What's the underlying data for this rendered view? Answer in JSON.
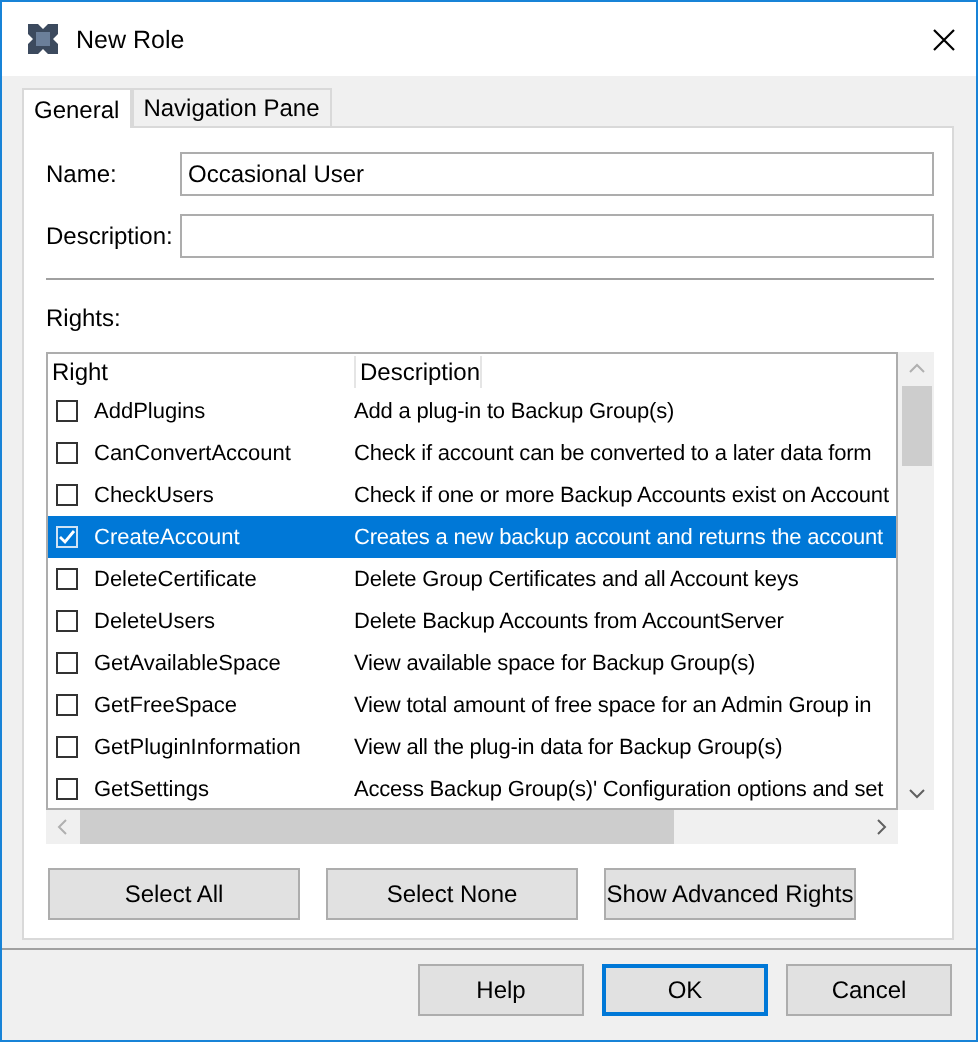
{
  "window": {
    "title": "New Role"
  },
  "tabs": [
    {
      "label": "General",
      "selected": true
    },
    {
      "label": "Navigation Pane",
      "selected": false
    }
  ],
  "name_field": {
    "label": "Name:",
    "value": "Occasional User"
  },
  "description_field": {
    "label": "Description:"
  },
  "rights": {
    "label": "Rights:",
    "columns": [
      "Right",
      "Description"
    ],
    "rows": [
      {
        "name": "AddPlugins",
        "description": "Add a plug-in to Backup Group(s)",
        "checked": false,
        "selected": false
      },
      {
        "name": "CanConvertAccount",
        "description": "Check if account can be converted to a later data form",
        "checked": false,
        "selected": false
      },
      {
        "name": "CheckUsers",
        "description": "Check if one or more Backup Accounts exist on Account",
        "checked": false,
        "selected": false
      },
      {
        "name": "CreateAccount",
        "description": "Creates a new backup account and returns the account",
        "checked": true,
        "selected": true
      },
      {
        "name": "DeleteCertificate",
        "description": "Delete Group Certificates and all Account keys",
        "checked": false,
        "selected": false
      },
      {
        "name": "DeleteUsers",
        "description": "Delete Backup Accounts from AccountServer",
        "checked": false,
        "selected": false
      },
      {
        "name": "GetAvailableSpace",
        "description": "View available space for Backup Group(s)",
        "checked": false,
        "selected": false
      },
      {
        "name": "GetFreeSpace",
        "description": "View total amount of free space for an Admin Group in",
        "checked": false,
        "selected": false
      },
      {
        "name": "GetPluginInformation",
        "description": "View all the plug-in data for Backup Group(s)",
        "checked": false,
        "selected": false
      },
      {
        "name": "GetSettings",
        "description": "Access Backup Group(s)' Configuration options and set",
        "checked": false,
        "selected": false
      }
    ]
  },
  "list_buttons": [
    "Select All",
    "Select None",
    "Show Advanced Rights"
  ],
  "dialog_buttons": [
    {
      "label": "Help",
      "default": false
    },
    {
      "label": "OK",
      "default": true
    },
    {
      "label": "Cancel",
      "default": false
    }
  ]
}
